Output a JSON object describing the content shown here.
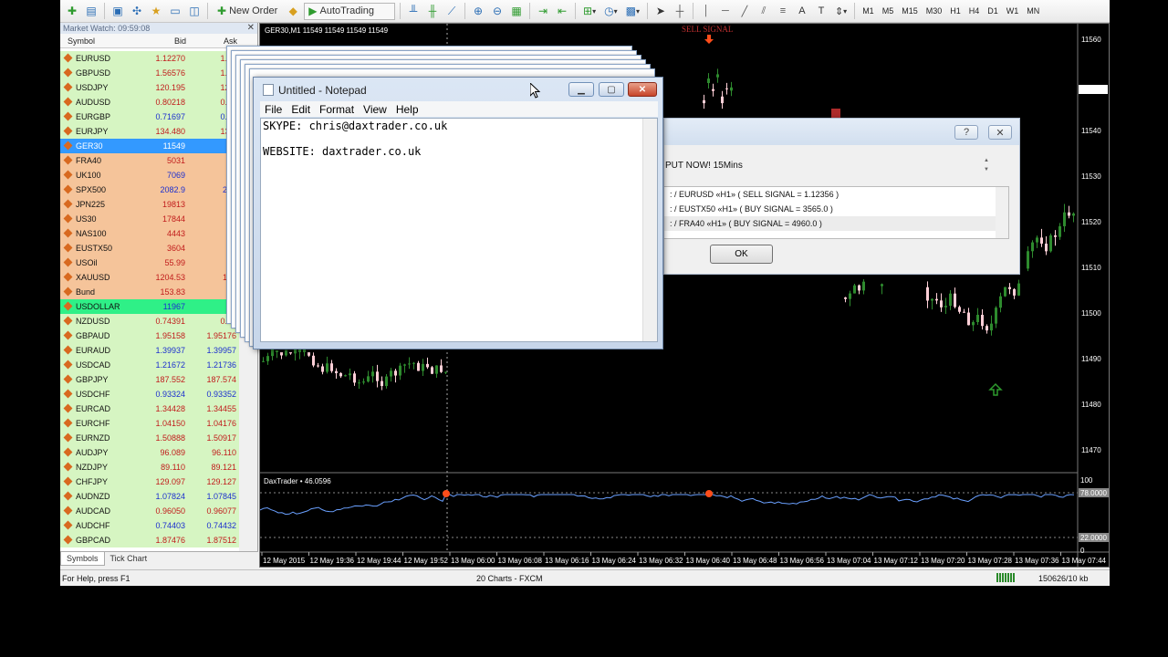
{
  "toolbar": {
    "new_order_label": "New Order",
    "autotrading_label": "AutoTrading",
    "timeframes": [
      "M1",
      "M5",
      "M15",
      "M30",
      "H1",
      "H4",
      "D1",
      "W1",
      "MN"
    ]
  },
  "market_watch": {
    "title": "Market Watch: 09:59:08",
    "columns": [
      "Symbol",
      "Bid",
      "Ask"
    ],
    "rows": [
      {
        "symbol": "EURUSD",
        "bid": "1.12270",
        "ask": "1.12",
        "style": "grn",
        "color": "red"
      },
      {
        "symbol": "GBPUSD",
        "bid": "1.56576",
        "ask": "1.56",
        "style": "grn",
        "color": "red"
      },
      {
        "symbol": "USDJPY",
        "bid": "120.195",
        "ask": "120.",
        "style": "grn",
        "color": "red"
      },
      {
        "symbol": "AUDUSD",
        "bid": "0.80218",
        "ask": "0.80",
        "style": "grn",
        "color": "red"
      },
      {
        "symbol": "EURGBP",
        "bid": "0.71697",
        "ask": "0.71",
        "style": "grn",
        "color": "blue"
      },
      {
        "symbol": "EURJPY",
        "bid": "134.480",
        "ask": "134.",
        "style": "grn",
        "color": "red"
      },
      {
        "symbol": "GER30",
        "bid": "11549",
        "ask": "11",
        "style": "sel",
        "color": "blue"
      },
      {
        "symbol": "FRA40",
        "bid": "5031",
        "ask": "5",
        "style": "tan",
        "color": "red"
      },
      {
        "symbol": "UK100",
        "bid": "7069",
        "ask": "7",
        "style": "tan",
        "color": "blue"
      },
      {
        "symbol": "SPX500",
        "bid": "2082.9",
        "ask": "208",
        "style": "tan",
        "color": "blue"
      },
      {
        "symbol": "JPN225",
        "bid": "19813",
        "ask": "19",
        "style": "tan",
        "color": "red"
      },
      {
        "symbol": "US30",
        "bid": "17844",
        "ask": "17",
        "style": "tan",
        "color": "red"
      },
      {
        "symbol": "NAS100",
        "bid": "4443",
        "ask": "4",
        "style": "tan",
        "color": "red"
      },
      {
        "symbol": "EUSTX50",
        "bid": "3604",
        "ask": "3",
        "style": "tan",
        "color": "red"
      },
      {
        "symbol": "USOil",
        "bid": "55.99",
        "ask": "5",
        "style": "tan",
        "color": "red"
      },
      {
        "symbol": "XAUUSD",
        "bid": "1204.53",
        "ask": "120",
        "style": "tan",
        "color": "red"
      },
      {
        "symbol": "Bund",
        "bid": "153.83",
        "ask": "15",
        "style": "tan",
        "color": "red"
      },
      {
        "symbol": "USDOLLAR",
        "bid": "11967",
        "ask": "11",
        "style": "bright",
        "color": "blue"
      },
      {
        "symbol": "NZDUSD",
        "bid": "0.74391",
        "ask": "0.74",
        "style": "grn",
        "color": "red"
      },
      {
        "symbol": "GBPAUD",
        "bid": "1.95158",
        "ask": "1.95176",
        "style": "grn",
        "color": "red"
      },
      {
        "symbol": "EURAUD",
        "bid": "1.39937",
        "ask": "1.39957",
        "style": "grn",
        "color": "blue"
      },
      {
        "symbol": "USDCAD",
        "bid": "1.21672",
        "ask": "1.21736",
        "style": "grn",
        "color": "blue"
      },
      {
        "symbol": "GBPJPY",
        "bid": "187.552",
        "ask": "187.574",
        "style": "grn",
        "color": "red"
      },
      {
        "symbol": "USDCHF",
        "bid": "0.93324",
        "ask": "0.93352",
        "style": "grn",
        "color": "blue"
      },
      {
        "symbol": "EURCAD",
        "bid": "1.34428",
        "ask": "1.34455",
        "style": "grn",
        "color": "red"
      },
      {
        "symbol": "EURCHF",
        "bid": "1.04150",
        "ask": "1.04176",
        "style": "grn",
        "color": "red"
      },
      {
        "symbol": "EURNZD",
        "bid": "1.50888",
        "ask": "1.50917",
        "style": "grn",
        "color": "red"
      },
      {
        "symbol": "AUDJPY",
        "bid": "96.089",
        "ask": "96.110",
        "style": "grn",
        "color": "red"
      },
      {
        "symbol": "NZDJPY",
        "bid": "89.110",
        "ask": "89.121",
        "style": "grn",
        "color": "red"
      },
      {
        "symbol": "CHFJPY",
        "bid": "129.097",
        "ask": "129.127",
        "style": "grn",
        "color": "red"
      },
      {
        "symbol": "AUDNZD",
        "bid": "1.07824",
        "ask": "1.07845",
        "style": "grn",
        "color": "blue"
      },
      {
        "symbol": "AUDCAD",
        "bid": "0.96050",
        "ask": "0.96077",
        "style": "grn",
        "color": "red"
      },
      {
        "symbol": "AUDCHF",
        "bid": "0.74403",
        "ask": "0.74432",
        "style": "grn",
        "color": "blue"
      },
      {
        "symbol": "GBPCAD",
        "bid": "1.87476",
        "ask": "1.87512",
        "style": "grn",
        "color": "red"
      }
    ],
    "tabs": [
      "Symbols",
      "Tick Chart"
    ]
  },
  "chart": {
    "title": "GER30,M1  11549 11549 11549 11549",
    "sell_signal_label": "SELL SIGNAL",
    "subwindow_title": "DaxTrader • 46.0596",
    "price_levels": [
      "11560",
      "11549",
      "11540",
      "11530",
      "11520",
      "11510",
      "11500",
      "11490",
      "11480",
      "11470"
    ],
    "sub_levels": [
      "100",
      "78.0000",
      "22.0000",
      "0"
    ],
    "time_labels": [
      "12 May 2015",
      "12 May 19:36",
      "12 May 19:44",
      "12 May 19:52",
      "13 May 06:00",
      "13 May 06:08",
      "13 May 06:16",
      "13 May 06:24",
      "13 May 06:32",
      "13 May 06:40",
      "13 May 06:48",
      "13 May 06:56",
      "13 May 07:04",
      "13 May 07:12",
      "13 May 07:20",
      "13 May 07:28",
      "13 May 07:36",
      "13 May 07:44"
    ],
    "colors": {
      "bull": "#2e8b2e",
      "bear": "#ffd0d8",
      "signal": "#ff4d1a",
      "line": "#6aa0ff"
    }
  },
  "notepad": {
    "title": "Untitled - Notepad",
    "menu": [
      "File",
      "Edit",
      "Format",
      "View",
      "Help"
    ],
    "content": "SKYPE: chris@daxtrader.co.uk\n\nWEBSITE: daxtrader.co.uk"
  },
  "alert": {
    "message": "PUT NOW! 15Mins",
    "items": [
      ": / EURUSD  «H1»  ( SELL SIGNAL = 1.12356 )",
      ": / EUSTX50  «H1»  ( BUY SIGNAL = 3565.0 )",
      ": / FRA40  «H1»  ( BUY SIGNAL = 4960.0 )"
    ],
    "ok_label": "OK"
  },
  "status": {
    "help": "For Help, press F1",
    "charts": "20 Charts - FXCM",
    "traffic": "150626/10 kb"
  }
}
